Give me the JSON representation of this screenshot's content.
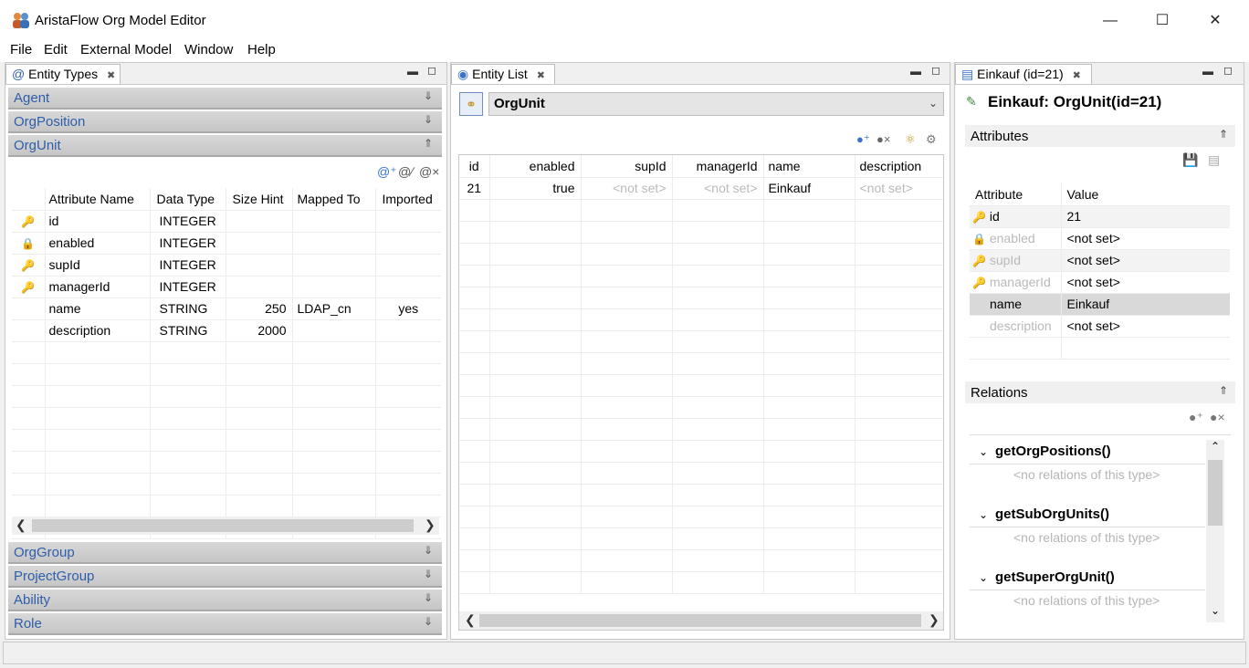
{
  "window": {
    "title": "AristaFlow Org Model Editor"
  },
  "menu": [
    "File",
    "Edit",
    "External Model",
    "Window",
    "Help"
  ],
  "entity_types": {
    "tab_label": "Entity Types",
    "groups_top": [
      "Agent",
      "OrgPosition",
      "OrgUnit"
    ],
    "groups_bottom": [
      "OrgGroup",
      "ProjectGroup",
      "Ability",
      "Role"
    ],
    "columns": [
      "Attribute Name",
      "Data Type",
      "Size Hint",
      "Mapped To",
      "Imported"
    ],
    "rows": [
      {
        "name": "id",
        "type": "INTEGER",
        "size": "",
        "mapped": "",
        "imported": "",
        "icon": "key-icon"
      },
      {
        "name": "enabled",
        "type": "INTEGER",
        "size": "",
        "mapped": "",
        "imported": "",
        "icon": "lock-icon"
      },
      {
        "name": "supId",
        "type": "INTEGER",
        "size": "",
        "mapped": "",
        "imported": "",
        "icon": "key-icon"
      },
      {
        "name": "managerId",
        "type": "INTEGER",
        "size": "",
        "mapped": "",
        "imported": "",
        "icon": "key-icon"
      },
      {
        "name": "name",
        "type": "STRING",
        "size": "250",
        "mapped": "LDAP_cn",
        "imported": "yes",
        "icon": ""
      },
      {
        "name": "description",
        "type": "STRING",
        "size": "2000",
        "mapped": "",
        "imported": "",
        "icon": ""
      }
    ]
  },
  "entity_list": {
    "tab_label": "Entity List",
    "selected_type": "OrgUnit",
    "columns": [
      "id",
      "enabled",
      "supId",
      "managerId",
      "name",
      "description"
    ],
    "rows": [
      {
        "id": "21",
        "enabled": "true",
        "supId": "<not set>",
        "managerId": "<not set>",
        "name": "Einkauf",
        "description": "<not set>"
      }
    ]
  },
  "details": {
    "tab_label": "Einkauf (id=21)",
    "heading": "Einkauf: OrgUnit(id=21)",
    "attributes_label": "Attributes",
    "attr_columns": [
      "Attribute",
      "Value"
    ],
    "attrs": [
      {
        "name": "id",
        "value": "21"
      },
      {
        "name": "enabled",
        "value": "<not set>"
      },
      {
        "name": "supId",
        "value": "<not set>"
      },
      {
        "name": "managerId",
        "value": "<not set>"
      },
      {
        "name": "name",
        "value": "Einkauf"
      },
      {
        "name": "description",
        "value": "<not set>"
      }
    ],
    "relations_label": "Relations",
    "relations": [
      {
        "title": "getOrgPositions()",
        "empty": "<no relations of this type>"
      },
      {
        "title": "getSubOrgUnits()",
        "empty": "<no relations of this type>"
      },
      {
        "title": "getSuperOrgUnit()",
        "empty": "<no relations of this type>"
      }
    ]
  },
  "colors": {
    "link_blue": "#2f5ea9",
    "accordion_bg": "#cfcfcf",
    "selection": "#d9d9d9"
  }
}
